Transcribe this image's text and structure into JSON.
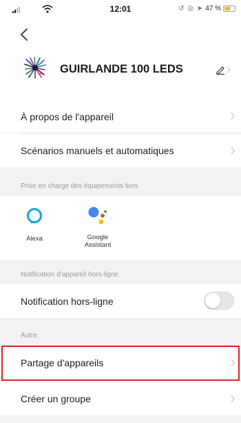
{
  "status_bar": {
    "time": "12:01",
    "battery_text": "47 %",
    "battery_level_percent": 47,
    "icons": [
      "signal-icon",
      "wifi-icon",
      "orientation-lock-icon",
      "alarm-icon",
      "location-icon",
      "battery-charging-icon"
    ]
  },
  "header": {
    "device_name": "GUIRLANDE 100 LEDS"
  },
  "rows": {
    "about": "À propos de l'appareil",
    "scenarios": "Scénarios manuels et automatiques"
  },
  "third_party": {
    "section_title": "Prise en charge des équipements tiers",
    "services": [
      {
        "name": "Alexa",
        "icon": "alexa-icon"
      },
      {
        "name": "Google\nAssistant",
        "icon": "google-assistant-icon"
      }
    ]
  },
  "offline": {
    "section_title": "Notification d'appareil hors-ligne",
    "label": "Notification hors-ligne",
    "enabled": false
  },
  "other": {
    "section_title": "Autre",
    "share": "Partage d'appareils",
    "group": "Créer un groupe"
  },
  "colors": {
    "highlight": "#e21f1f",
    "alexa": "#1aa8dc",
    "google_blue": "#4285f4",
    "google_red": "#ea4335",
    "google_yellow": "#fbbc05",
    "google_green": "#34a853"
  }
}
